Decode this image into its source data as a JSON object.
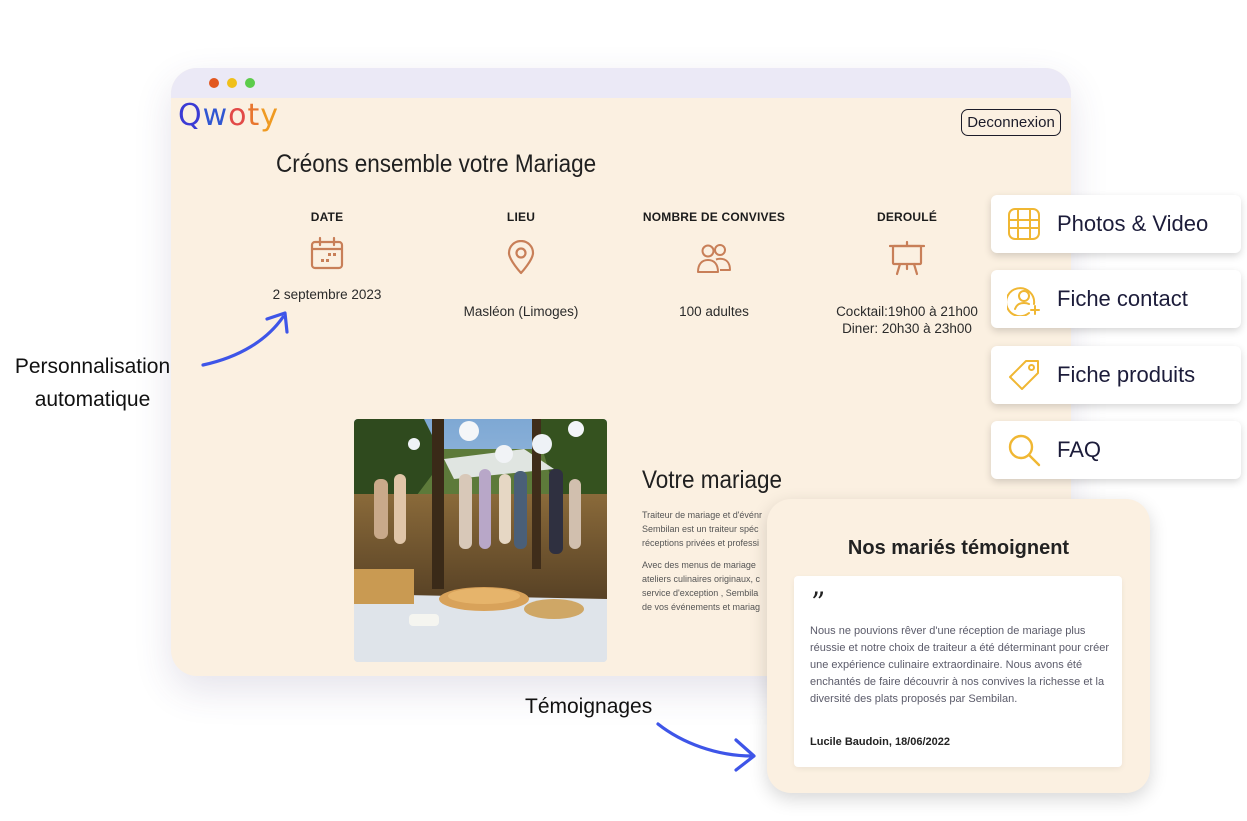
{
  "app": {
    "logo_letters": [
      "Q",
      "w",
      "o",
      "t",
      "y"
    ],
    "logo_colors": [
      "#3b3bd4",
      "#3157d2",
      "#e24a48",
      "#e8762f",
      "#ef9a22"
    ],
    "logout_label": "Deconnexion"
  },
  "page": {
    "title": "Créons ensemble votre Mariage",
    "info": [
      {
        "label": "DATE",
        "icon": "calendar-icon",
        "value_lines": [
          "2 septembre 2023"
        ]
      },
      {
        "label": "LIEU",
        "icon": "map-pin-icon",
        "value_lines": [
          "Masléon (Limoges)"
        ]
      },
      {
        "label": "NOMBRE DE CONVIVES",
        "icon": "people-icon",
        "value_lines": [
          "100 adultes"
        ]
      },
      {
        "label": "DEROULÉ",
        "icon": "easel-icon",
        "value_lines": [
          "Cocktail:19h00 à 21h00",
          "Diner: 20h30 à 23h00"
        ]
      }
    ],
    "accent_color": "#c87f58",
    "section_title": "Votre mariage",
    "paragraph_1": [
      "Traiteur de mariage et d'événr",
      "Sembilan est un traiteur spéc",
      "réceptions privées et professi"
    ],
    "paragraph_2": [
      "Avec des menus de mariage",
      "ateliers culinaires originaux, c",
      "service d'exception , Sembila",
      "de vos événements et mariag"
    ]
  },
  "side_menu": [
    {
      "label": "Photos & Video",
      "icon": "film-grid-icon"
    },
    {
      "label": "Fiche contact",
      "icon": "contact-icon"
    },
    {
      "label": "Fiche produits",
      "icon": "tag-icon"
    },
    {
      "label": "FAQ",
      "icon": "search-icon"
    }
  ],
  "side_menu_icon_color": "#f0b733",
  "testimonial": {
    "title": "Nos mariés témoignent",
    "quote_mark": "”",
    "text": "Nous ne pouvions rêver d'une réception de mariage plus réussie et notre choix de traiteur a été déterminant pour créer une expérience culinaire extraordinaire. Nous avons été enchantés de faire découvrir à nos convives la richesse et la diversité des plats proposés par Sembilan.",
    "author": "Lucile Baudoin, 18/06/2022"
  },
  "callouts": {
    "personalisation": [
      "Personnalisation",
      "automatique"
    ],
    "testimonials": "Témoignages",
    "arrow_color": "#3e55e8"
  }
}
